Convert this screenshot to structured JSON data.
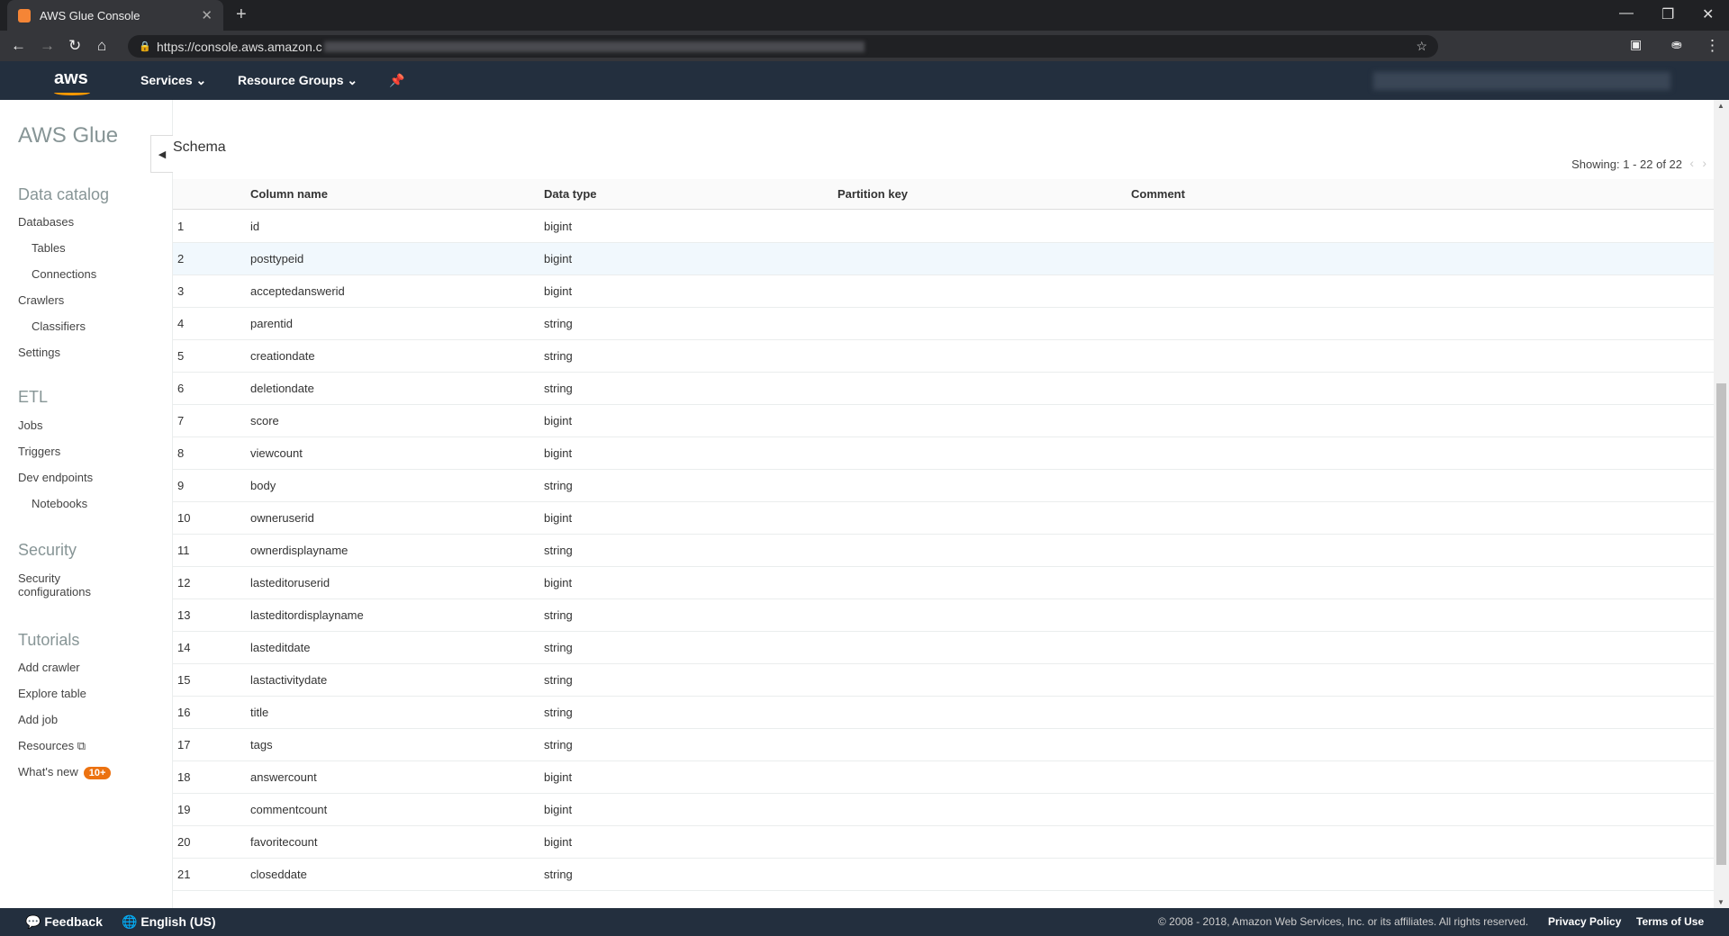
{
  "browser": {
    "tab_title": "AWS Glue Console",
    "url": "https://console.aws.amazon.c"
  },
  "nav": {
    "logo": "aws",
    "services": "Services",
    "resource_groups": "Resource Groups"
  },
  "sidebar": {
    "title": "AWS Glue",
    "sections": [
      {
        "heading": "Data catalog",
        "items": [
          {
            "label": "Databases",
            "indent": false
          },
          {
            "label": "Tables",
            "indent": true
          },
          {
            "label": "Connections",
            "indent": true
          },
          {
            "label": "Crawlers",
            "indent": false
          },
          {
            "label": "Classifiers",
            "indent": true
          },
          {
            "label": "Settings",
            "indent": false
          }
        ]
      },
      {
        "heading": "ETL",
        "items": [
          {
            "label": "Jobs",
            "indent": false
          },
          {
            "label": "Triggers",
            "indent": false
          },
          {
            "label": "Dev endpoints",
            "indent": false
          },
          {
            "label": "Notebooks",
            "indent": true
          }
        ]
      },
      {
        "heading": "Security",
        "items": [
          {
            "label": "Security configurations",
            "indent": false
          }
        ]
      },
      {
        "heading": "Tutorials",
        "items": [
          {
            "label": "Add crawler",
            "indent": false
          },
          {
            "label": "Explore table",
            "indent": false
          },
          {
            "label": "Add job",
            "indent": false
          },
          {
            "label": "Resources",
            "indent": false,
            "external": true
          },
          {
            "label": "What's new",
            "indent": false,
            "badge": "10+"
          }
        ]
      }
    ]
  },
  "schema": {
    "title": "Schema",
    "showing": "Showing: 1 - 22 of 22",
    "columns": [
      "",
      "Column name",
      "Data type",
      "Partition key",
      "Comment"
    ],
    "rows": [
      [
        "1",
        "id",
        "bigint"
      ],
      [
        "2",
        "posttypeid",
        "bigint"
      ],
      [
        "3",
        "acceptedanswerid",
        "bigint"
      ],
      [
        "4",
        "parentid",
        "string"
      ],
      [
        "5",
        "creationdate",
        "string"
      ],
      [
        "6",
        "deletiondate",
        "string"
      ],
      [
        "7",
        "score",
        "bigint"
      ],
      [
        "8",
        "viewcount",
        "bigint"
      ],
      [
        "9",
        "body",
        "string"
      ],
      [
        "10",
        "owneruserid",
        "bigint"
      ],
      [
        "11",
        "ownerdisplayname",
        "string"
      ],
      [
        "12",
        "lasteditoruserid",
        "bigint"
      ],
      [
        "13",
        "lasteditordisplayname",
        "string"
      ],
      [
        "14",
        "lasteditdate",
        "string"
      ],
      [
        "15",
        "lastactivitydate",
        "string"
      ],
      [
        "16",
        "title",
        "string"
      ],
      [
        "17",
        "tags",
        "string"
      ],
      [
        "18",
        "answercount",
        "bigint"
      ],
      [
        "19",
        "commentcount",
        "bigint"
      ],
      [
        "20",
        "favoritecount",
        "bigint"
      ],
      [
        "21",
        "closeddate",
        "string"
      ]
    ],
    "highlighted_row": 2
  },
  "footer": {
    "feedback": "Feedback",
    "language": "English (US)",
    "copyright": "© 2008 - 2018, Amazon Web Services, Inc. or its affiliates. All rights reserved.",
    "privacy": "Privacy Policy",
    "terms": "Terms of Use"
  },
  "colors": {
    "nav_bg": "#232f3e",
    "accent": "#ec7211",
    "highlight_row": "#f1f8fd"
  }
}
